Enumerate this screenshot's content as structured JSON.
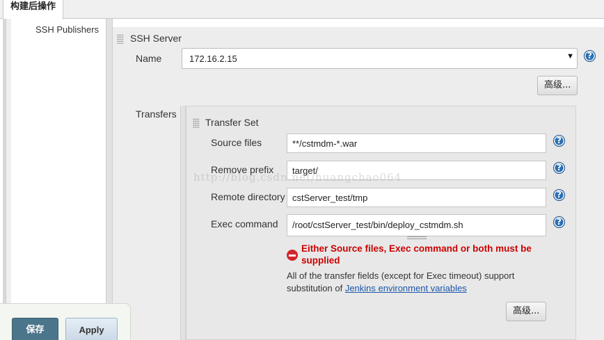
{
  "tab": {
    "label": "构建后操作"
  },
  "publisher": {
    "label": "SSH Publishers",
    "server": {
      "title": "SSH Server",
      "name_label": "Name",
      "name_value": "172.16.2.15",
      "advanced_label": "高级..."
    },
    "transfers": {
      "label": "Transfers",
      "set_title": "Transfer Set",
      "source_files_label": "Source files",
      "source_files_value": "**/cstmdm-*.war",
      "remove_prefix_label": "Remove prefix",
      "remove_prefix_value": "target/",
      "remote_dir_label": "Remote directory",
      "remote_dir_value": "cstServer_test/tmp",
      "exec_command_label": "Exec command",
      "exec_command_value": "/root/cstServer_test/bin/deploy_cstmdm.sh",
      "error": "Either Source files, Exec command or both must be supplied",
      "note_prefix": "All of the transfer fields (except for Exec timeout) support substitution of ",
      "note_link": "Jenkins environment variables",
      "advanced_label": "高级..."
    }
  },
  "watermark": "http://blog.csdn.net/huangchao064",
  "footer": {
    "save_label": "保存",
    "apply_label": "Apply"
  },
  "colors": {
    "error": "#cc0000",
    "link": "#1a56a8",
    "save_button": "#4b758b",
    "help_icon": "#2a6fb4"
  },
  "icons": {
    "help": "question-circle-icon",
    "error": "no-entry-icon",
    "grip": "drag-handle-icon",
    "dropdown": "triangle-down-icon"
  }
}
